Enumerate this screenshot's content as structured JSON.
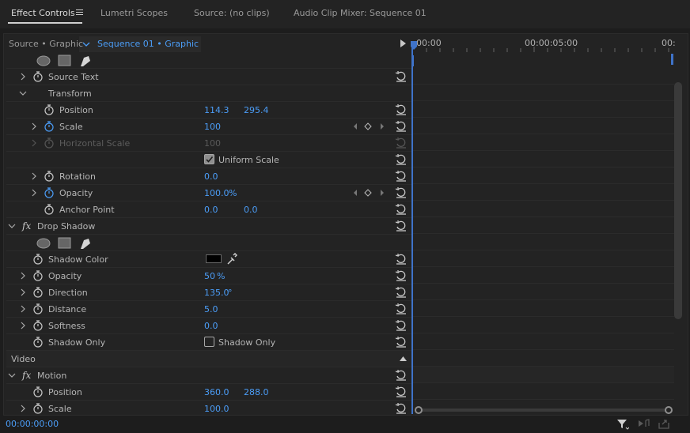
{
  "tabs": [
    {
      "label": "Effect Controls",
      "active": true
    },
    {
      "label": "Lumetri Scopes"
    },
    {
      "label": "Source: (no clips)"
    },
    {
      "label": "Audio Clip Mixer: Sequence 01"
    }
  ],
  "subtabs": {
    "source": "Source • Graphic",
    "sequence": "Sequence 01 • Graphic"
  },
  "ruler": {
    "t0": "00:00",
    "t5": "00:00:05:00",
    "t10": "00:"
  },
  "rows": {
    "source_text": "Source Text",
    "transform": "Transform",
    "position": {
      "label": "Position",
      "x": "114.3",
      "y": "295.4"
    },
    "scale": {
      "label": "Scale",
      "value": "100"
    },
    "horizontal_scale": {
      "label": "Horizontal Scale",
      "value": "100"
    },
    "uniform_scale": "Uniform Scale",
    "rotation": {
      "label": "Rotation",
      "value": "0.0"
    },
    "opacity": {
      "label": "Opacity",
      "value": "100.0",
      "unit": "%"
    },
    "anchor_point": {
      "label": "Anchor Point",
      "x": "0.0",
      "y": "0.0"
    },
    "drop_shadow": "Drop Shadow",
    "shadow_color": {
      "label": "Shadow Color",
      "color": "#000000"
    },
    "ds_opacity": {
      "label": "Opacity",
      "value": "50",
      "unit": "%"
    },
    "direction": {
      "label": "Direction",
      "value": "135.0",
      "unit": "°"
    },
    "distance": {
      "label": "Distance",
      "value": "5.0"
    },
    "softness": {
      "label": "Softness",
      "value": "0.0"
    },
    "shadow_only": {
      "label": "Shadow Only",
      "checkbox": "Shadow Only"
    },
    "video": "Video",
    "motion": "Motion",
    "m_position": {
      "label": "Position",
      "x": "360.0",
      "y": "288.0"
    },
    "m_scale": {
      "label": "Scale",
      "value": "100.0"
    }
  },
  "fx_symbol": "fx",
  "footer": {
    "timecode": "00:00:00:00"
  },
  "colors": {
    "accent": "#4b9df7",
    "panel": "#232323",
    "text": "#b5b5b5"
  }
}
